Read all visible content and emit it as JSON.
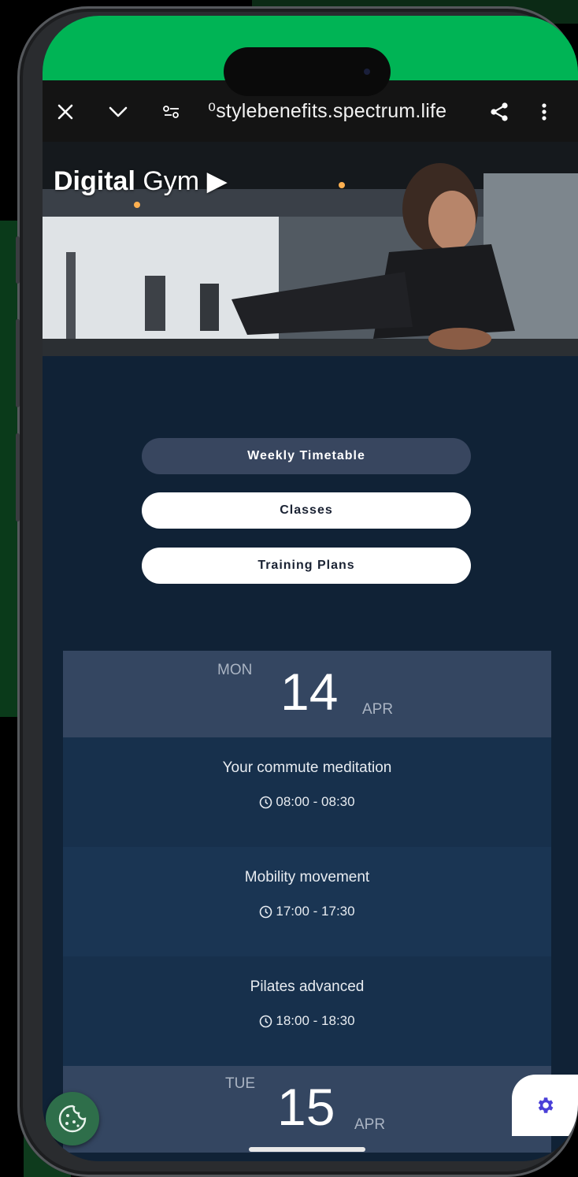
{
  "browser": {
    "url": "⁰stylebenefits.spectrum.life",
    "close_icon": "close-icon",
    "collapse_icon": "chevron-down-icon",
    "site_settings_icon": "tune-icon",
    "share_icon": "share-icon",
    "menu_icon": "more-vert-icon"
  },
  "hero": {
    "title_bold": "Digital",
    "title_rest": " Gym ▶"
  },
  "nav": {
    "buttons": [
      {
        "label": "Weekly Timetable",
        "active": true
      },
      {
        "label": "Classes",
        "active": false
      },
      {
        "label": "Training Plans",
        "active": false
      }
    ]
  },
  "schedule": {
    "days": [
      {
        "dow": "MON",
        "day": "14",
        "month": "APR",
        "events": [
          {
            "title": "Your commute meditation",
            "time": "08:00 - 08:30"
          },
          {
            "title": "Mobility movement",
            "time": "17:00 - 17:30"
          },
          {
            "title": "Pilates advanced",
            "time": "18:00 - 18:30"
          }
        ]
      },
      {
        "dow": "TUE",
        "day": "15",
        "month": "APR",
        "events": []
      }
    ]
  },
  "colors": {
    "status_bar": "#00b455",
    "page_bg": "#102236",
    "day_header": "#344661",
    "active_pill": "#38465f",
    "settings_icon": "#4a3fd8"
  },
  "widgets": {
    "cookie_icon": "cookie-icon",
    "settings_icon": "gear-icon"
  }
}
